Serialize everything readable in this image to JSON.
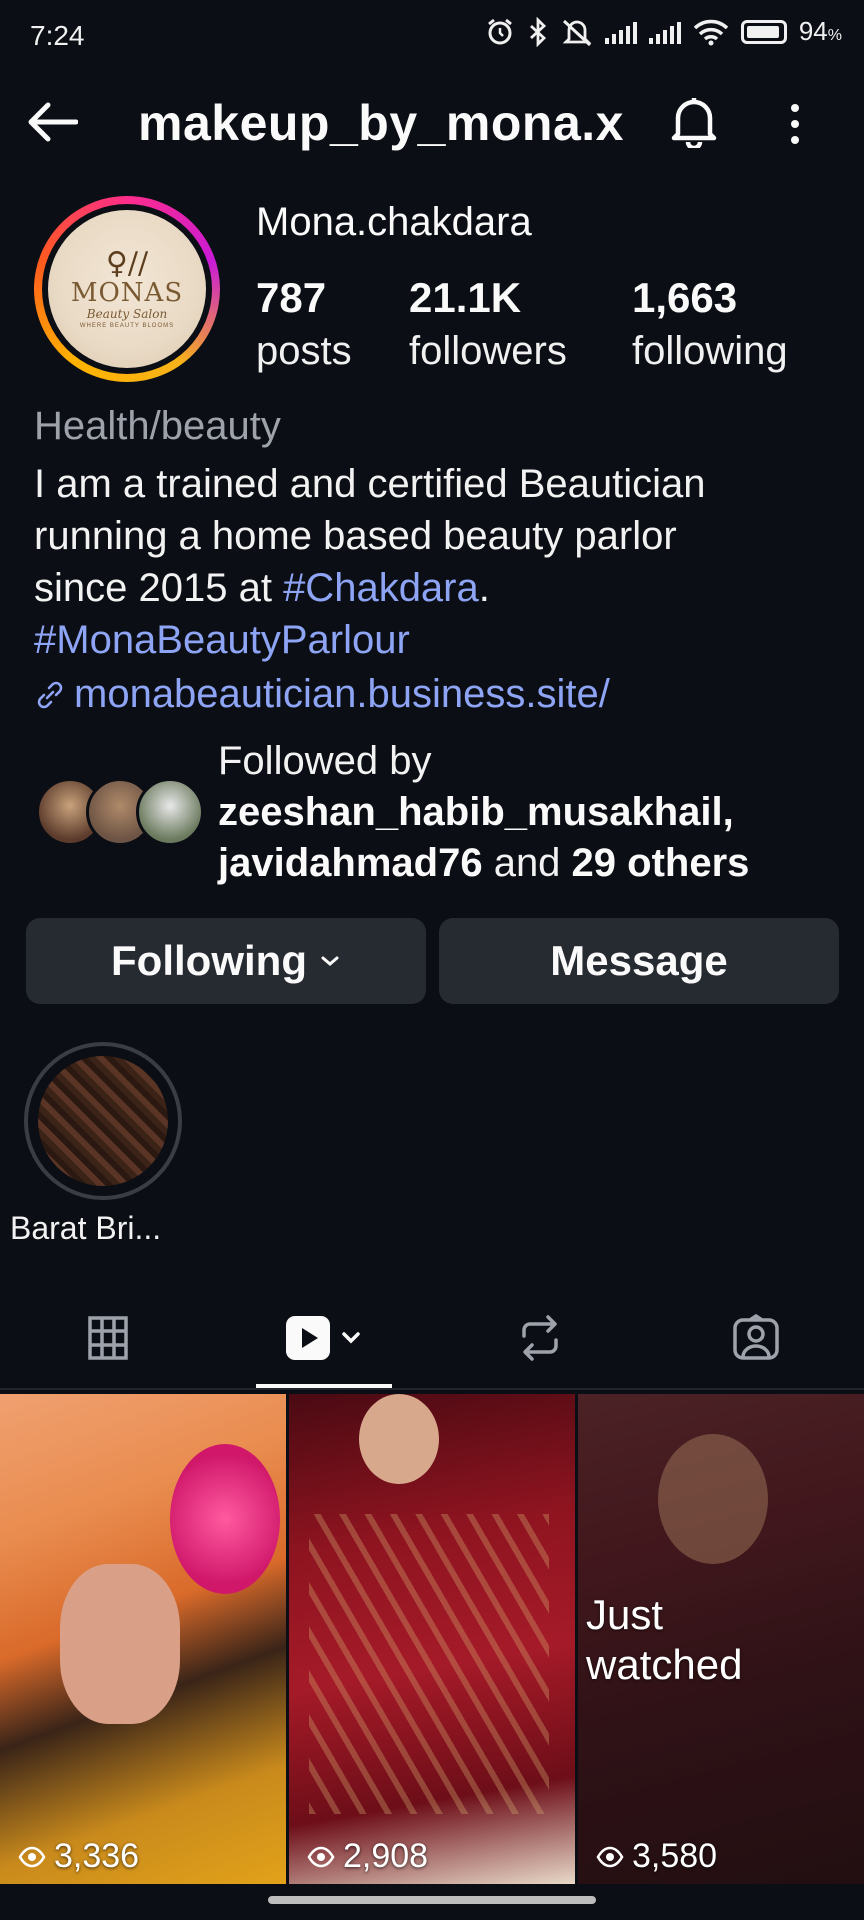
{
  "status_bar": {
    "time": "7:24",
    "battery_pct": "94",
    "battery_unit": "%",
    "icons": [
      "alarm-icon",
      "bluetooth-icon",
      "mute-icon",
      "signal-icon",
      "signal-icon",
      "wifi-icon",
      "battery-icon"
    ]
  },
  "header": {
    "username": "makeup_by_mona.x",
    "icons": [
      "back-arrow-icon",
      "bell-icon",
      "more-vertical-icon"
    ]
  },
  "profile": {
    "avatar_logo": {
      "name": "MONAS",
      "subtitle": "Beauty Salon",
      "tagline": "WHERE BEAUTY BLOOMS"
    },
    "display_name": "Mona.chakdara",
    "stats": [
      {
        "value": "787",
        "label": "posts"
      },
      {
        "value": "21.1K",
        "label": "followers"
      },
      {
        "value": "1,663",
        "label": "following"
      }
    ],
    "category": "Health/beauty",
    "bio": {
      "line1": "I am a trained and certified Beautician",
      "line2": "running a home based beauty parlor",
      "line3_prefix": "since 2015 at ",
      "line3_tag": "#Chakdara",
      "line3_suffix": ".",
      "line4_tag": "#MonaBeautyParlour"
    },
    "link": "monabeautician.business.site/"
  },
  "followed_by": {
    "intro": "Followed by",
    "user1": "zeeshan_habib_musakhail,",
    "user2": "javidahmad76",
    "joiner": " and ",
    "others": "29 others"
  },
  "actions": {
    "following_label": "Following",
    "message_label": "Message"
  },
  "highlights": [
    {
      "label": "Barat Bri..."
    }
  ],
  "tabs": [
    {
      "name": "grid-icon",
      "selected": false
    },
    {
      "name": "reels-icon",
      "selected": true
    },
    {
      "name": "reposts-icon",
      "selected": false
    },
    {
      "name": "tagged-icon",
      "selected": false
    }
  ],
  "reels": [
    {
      "views": "3,336",
      "overlay": ""
    },
    {
      "views": "2,908",
      "overlay": ""
    },
    {
      "views": "3,580",
      "overlay_line1": "Just",
      "overlay_line2": "watched"
    }
  ],
  "colors": {
    "background": "#0b0e14",
    "link": "#8ea4f5",
    "button": "#262a31",
    "secondary_text": "#9ea3ab"
  }
}
